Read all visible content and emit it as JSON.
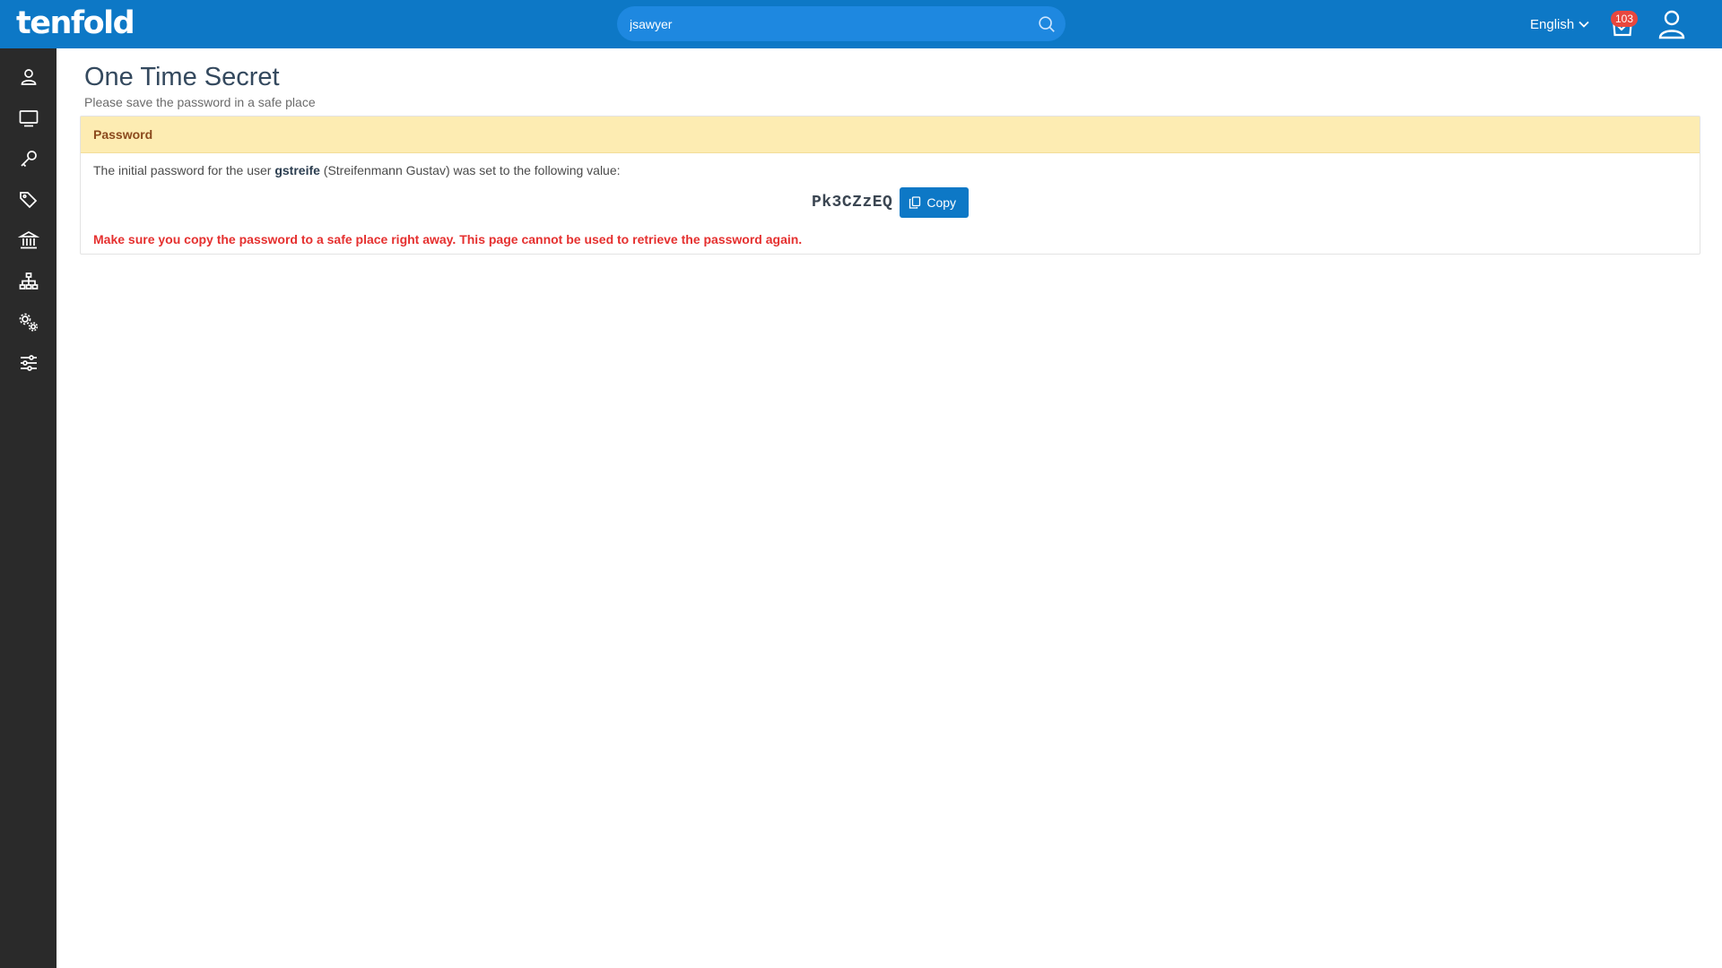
{
  "app": {
    "logo_text": "tenfold",
    "brand_color": "#0d78c6",
    "sidebar_color": "#2a2a2a"
  },
  "search": {
    "value": "jsawyer",
    "placeholder": ""
  },
  "header": {
    "language": "English",
    "notifications_count": "103"
  },
  "sidebar": {
    "items": [
      {
        "icon": "user-icon"
      },
      {
        "icon": "monitor-icon"
      },
      {
        "icon": "key-icon"
      },
      {
        "icon": "tags-icon"
      },
      {
        "icon": "institution-icon"
      },
      {
        "icon": "sitemap-icon"
      },
      {
        "icon": "gears-icon"
      },
      {
        "icon": "sliders-icon"
      }
    ]
  },
  "page": {
    "title": "One Time Secret",
    "subtitle": "Please save the password in a safe place"
  },
  "panel": {
    "header": "Password",
    "header_bg": "#fdecb2",
    "info_prefix": "The initial password for the user",
    "username": "gstreife",
    "info_suffix": "(Streifenmann Gustav) was set to the following value:",
    "password": "Pk3CZzEQ",
    "copy_label": "Copy",
    "warning": "Make sure you copy the password to a safe place right away. This page cannot be used to retrieve the password again.",
    "warning_color": "#e5302f"
  }
}
